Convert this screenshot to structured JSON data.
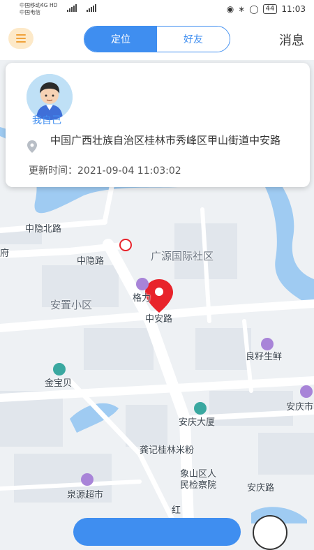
{
  "status_bar": {
    "carrier1": "中国移动4G HD",
    "carrier2": "中国电信",
    "battery": "44",
    "time": "11:03"
  },
  "header": {
    "menu_icon": "menu-icon",
    "tabs": [
      {
        "label": "定位",
        "active": true
      },
      {
        "label": "好友",
        "active": false
      }
    ],
    "messages_label": "消息"
  },
  "card": {
    "name": "我自己",
    "address": "中国广西壮族自治区桂林市秀峰区甲山街道中安路",
    "time_label": "更新时间：",
    "time_value": "2021-09-04 11:03:02"
  },
  "map": {
    "labels": [
      "中隐北路",
      "府",
      "中隐路",
      "广源国际社区",
      "格力",
      "安置小区",
      "中安路",
      "良籽生鲜",
      "金宝贝",
      "安庆市",
      "安庆大厦",
      "龚记桂林米粉",
      "象山区人",
      "民检察院",
      "安庆路",
      "泉源超市",
      "红"
    ]
  },
  "colors": {
    "accent": "#3f8ef0",
    "pin": "#e8232b",
    "water": "#9fcbf2",
    "menu_bg": "#fde9c8"
  }
}
